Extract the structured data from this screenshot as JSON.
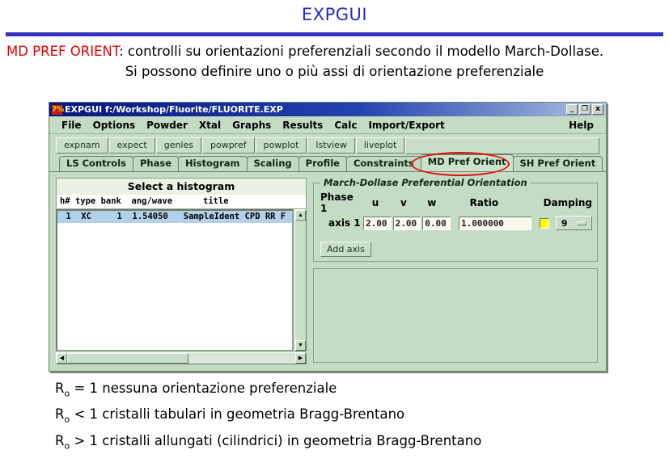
{
  "slide": {
    "title": "EXPGUI",
    "caption_highlight": "MD PREF ORIENT",
    "caption_rest": ": controlli su orientazioni preferenziali secondo il modello March-Dollase.",
    "caption_line2": "Si possono definire uno o più assi di orientazione preferenziale",
    "accent_blue": "#3333bb",
    "highlight_red": "#e00000"
  },
  "window": {
    "icon_label": "7%",
    "title": "EXPGUI f:/Workshop/Fluorite/FLUORITE.EXP",
    "buttons": {
      "minimize": "_",
      "maximize": "❐",
      "close": "x"
    }
  },
  "menubar": {
    "items": [
      "File",
      "Options",
      "Powder",
      "Xtal",
      "Graphs",
      "Results",
      "Calc",
      "Import/Export"
    ],
    "help": "Help"
  },
  "toolbar": {
    "buttons": [
      "expnam",
      "expect",
      "genles",
      "powpref",
      "powplot",
      "lstview",
      "liveplot"
    ]
  },
  "tabs": [
    {
      "label": "LS Controls",
      "selected": false
    },
    {
      "label": "Phase",
      "selected": false
    },
    {
      "label": "Histogram",
      "selected": false
    },
    {
      "label": "Scaling",
      "selected": false
    },
    {
      "label": "Profile",
      "selected": false
    },
    {
      "label": "Constraints",
      "selected": false
    },
    {
      "label": "MD Pref Orient",
      "selected": true
    },
    {
      "label": "SH Pref Orient",
      "selected": false
    }
  ],
  "histogram": {
    "title": "Select a histogram",
    "column_header": "h# type bank  ang/wave      title",
    "rows": [
      " 1  XC     1  1.54050   SampleIdent CPD RR F"
    ]
  },
  "md_panel": {
    "legend": "March-Dollase Preferential Orientation",
    "headers": {
      "phase": "Phase 1",
      "u": "u",
      "v": "v",
      "w": "w",
      "ratio": "Ratio",
      "damping": "Damping"
    },
    "axis_row": {
      "label": "axis 1",
      "u": "2.00",
      "v": "2.00",
      "w": "0.00",
      "ratio": "1.000000",
      "refine_color": "#ffff00",
      "damping": "9"
    },
    "add_axis_label": "Add axis"
  },
  "footer": {
    "lines": [
      {
        "prefix": "R",
        "sub": "o",
        "text": " = 1 nessuna orientazione preferenziale"
      },
      {
        "prefix": "R",
        "sub": "o",
        "text": " < 1 cristalli tabulari in geometria Bragg-Brentano"
      },
      {
        "prefix": "R",
        "sub": "o",
        "text": " > 1 cristalli allungati (cilindrici) in geometria Bragg-Brentano"
      }
    ]
  }
}
